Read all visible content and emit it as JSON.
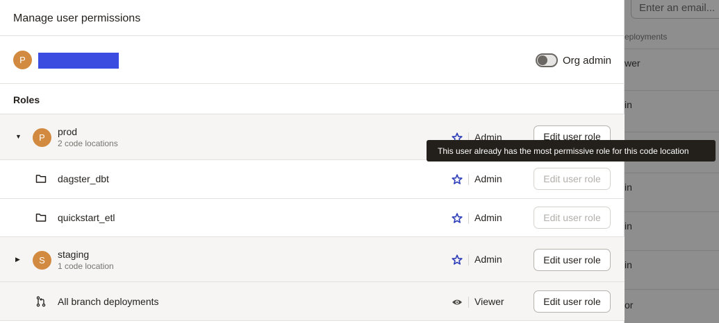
{
  "background": {
    "search_placeholder": "Enter an email...",
    "column_header": "eployments",
    "rows": [
      "wer",
      "in",
      "",
      "in",
      "in",
      "in",
      "or"
    ]
  },
  "modal": {
    "title": "Manage user permissions",
    "user": {
      "avatar_initial": "P",
      "org_admin_label": "Org admin",
      "org_admin_enabled": false
    },
    "roles_label": "Roles",
    "rows": [
      {
        "avatar": "P",
        "title": "prod",
        "subtitle": "2 code locations",
        "role": "Admin",
        "button": "Edit user role",
        "expanded": true
      },
      {
        "title": "dagster_dbt",
        "role": "Admin",
        "button": "Edit user role",
        "disabled": true
      },
      {
        "title": "quickstart_etl",
        "role": "Admin",
        "button": "Edit user role",
        "disabled": true
      },
      {
        "avatar": "S",
        "title": "staging",
        "subtitle": "1 code location",
        "role": "Admin",
        "button": "Edit user role",
        "expanded": false
      },
      {
        "title": "All branch deployments",
        "role": "Viewer",
        "button": "Edit user role"
      }
    ]
  },
  "tooltip": "This user already has the most permissive role for this code location",
  "colors": {
    "avatar": "#d18a3f",
    "star": "#2a3bb7",
    "redaction": "#3a4de0",
    "tooltip_bg": "#231f1b"
  },
  "icons": {
    "caret_down": "caret-down-icon",
    "caret_right": "caret-right-icon",
    "folder": "folder-icon",
    "star": "star-icon",
    "branch": "git-branch-icon",
    "eye": "eye-icon"
  }
}
